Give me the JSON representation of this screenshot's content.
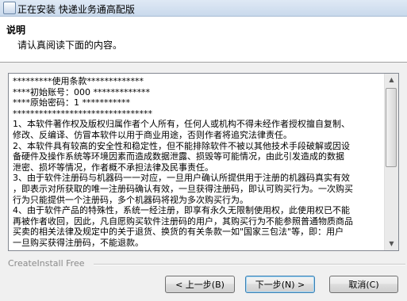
{
  "window": {
    "title": "正在安装 快递业务通高配版"
  },
  "header": {
    "title": "说明",
    "subtitle": "请认真阅读下面的内容。"
  },
  "license": {
    "lines": [
      "*********使用条款*************",
      "****初始账号：000 *************",
      "****原始密码：1    ***********",
      "********************************",
      "1、本软件著作权及版权归属作者个人所有，任何人或机构不得未经作者授权擅自复制、",
      "修改、反编译、仿冒本软件以用于商业用途，否则作者将追究法律责任。",
      "2、本软件具有较高的安全性和稳定性，但不能排除软件不被以其他技术手段破解或因设",
      "备硬件及操作系统等环境因素而造成数据泄露、损毁等可能情况，由此引发造成的数据",
      "泄密、损坏等情况，作者概不承担法律及民事责任。",
      "3、由于软件注册码与机器码一一对应，一旦用户确认所提供用于注册的机器码真实有效",
      "，即表示对所获取的唯一注册码确认有效，一旦获得注册码，即认可购买行为。一次购买",
      "行为只能提供一个注册码，多个机器码将视为多次购买行为。",
      "4、由于软件产品的特殊性，系统一经注册，即享有永久无限制使用权，此使用权已不能",
      "再被作者收回，因此，凡自愿购买软件注册码的用户，其购买行为不能参照普通物质商品",
      "买卖的相关法律及规定中的关于退货、换货的有关条款一如\"国家三包法\"等，即：用户",
      "一旦购买获得注册码，不能退款。"
    ]
  },
  "footer": {
    "brand": "CreateInstall Free"
  },
  "buttons": {
    "back": "< 上一步(B)",
    "next": "下一步(N) >",
    "cancel": "取消(C)"
  },
  "icons": {
    "app": "installer-icon",
    "scroll_up": "scroll-up-arrow-icon",
    "scroll_down": "scroll-down-arrow-icon"
  }
}
